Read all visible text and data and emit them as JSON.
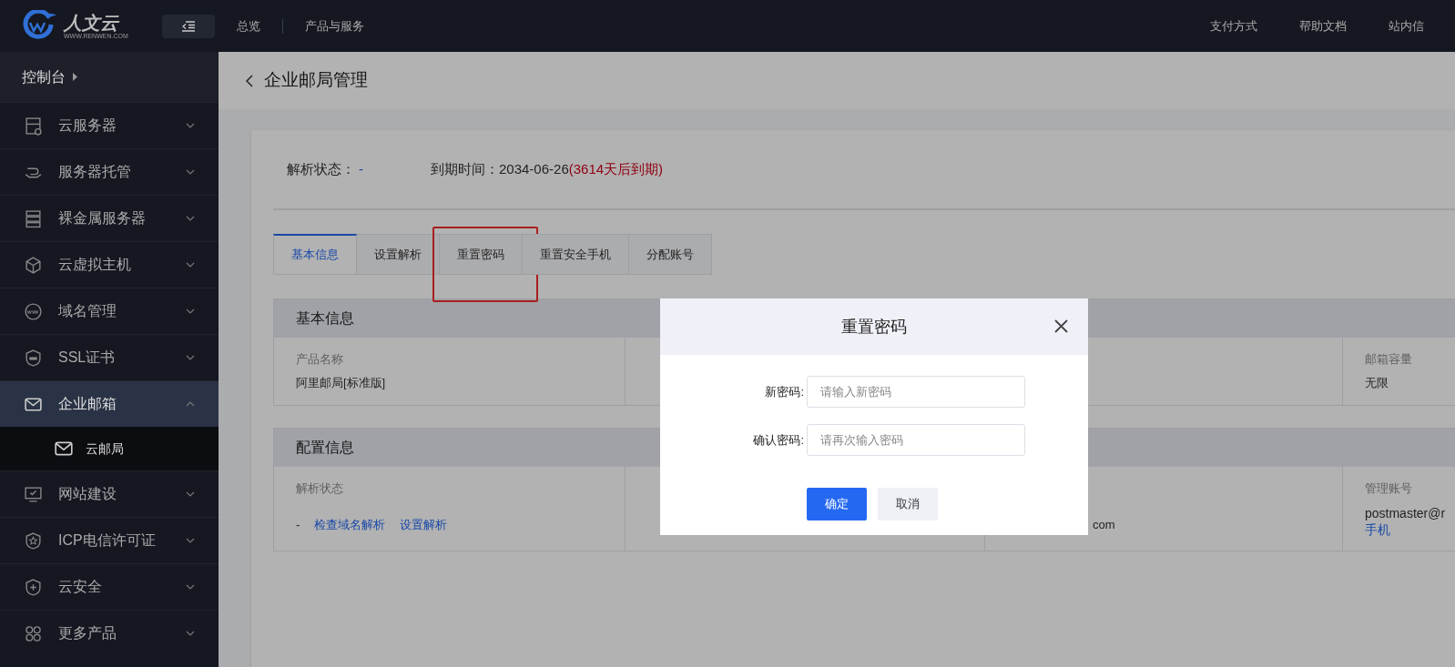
{
  "header": {
    "logo_text": "人文云",
    "logo_sub": "WWW.RENWEN.COM",
    "nav": [
      "总览",
      "产品与服务"
    ],
    "right_links": [
      "支付方式",
      "帮助文档",
      "站内信"
    ]
  },
  "sidebar": {
    "title": "控制台",
    "items": [
      {
        "label": "云服务器",
        "expanded": false,
        "selected": false
      },
      {
        "label": "服务器托管",
        "expanded": false,
        "selected": false
      },
      {
        "label": "裸金属服务器",
        "expanded": false,
        "selected": false
      },
      {
        "label": "云虚拟主机",
        "expanded": false,
        "selected": false
      },
      {
        "label": "域名管理",
        "expanded": false,
        "selected": false
      },
      {
        "label": "SSL证书",
        "expanded": false,
        "selected": false
      },
      {
        "label": "企业邮箱",
        "expanded": true,
        "selected": true,
        "children": [
          {
            "label": "云邮局"
          }
        ]
      },
      {
        "label": "网站建设",
        "expanded": false,
        "selected": false
      },
      {
        "label": "ICP电信许可证",
        "expanded": false,
        "selected": false
      },
      {
        "label": "云安全",
        "expanded": false,
        "selected": false
      },
      {
        "label": "更多产品",
        "expanded": false,
        "selected": false
      }
    ]
  },
  "page": {
    "title": "企业邮局管理",
    "status": [
      {
        "label": "解析状态：",
        "value": "-",
        "kind": "link"
      },
      {
        "label": "到期时间：",
        "value": "2034-06-26",
        "note": "(3614天后到期)",
        "kind": "date"
      }
    ],
    "tabs": [
      {
        "label": "基本信息",
        "selected": true,
        "highlighted": false
      },
      {
        "label": "设置解析",
        "selected": false,
        "highlighted": false
      },
      {
        "label": "重置密码",
        "selected": false,
        "highlighted": true
      },
      {
        "label": "重置安全手机",
        "selected": false,
        "highlighted": false
      },
      {
        "label": "分配账号",
        "selected": false,
        "highlighted": false
      }
    ],
    "sections": [
      {
        "title": "基本信息",
        "cells": [
          {
            "label": "产品名称",
            "values": [
              {
                "text": "阿里邮局[标准版]",
                "kind": "text"
              }
            ]
          },
          {},
          {},
          {
            "label": "邮箱容量",
            "values": [
              {
                "text": "无限",
                "kind": "text"
              }
            ]
          }
        ]
      },
      {
        "title": "配置信息",
        "cells": [
          {
            "label": "解析状态",
            "values": [
              {
                "text": "-",
                "kind": "text"
              },
              {
                "text": "检查域名解析",
                "kind": "link"
              },
              {
                "text": "设置解析",
                "kind": "link"
              }
            ]
          },
          {},
          {
            "values": [
              {
                "text": "com",
                "kind": "text"
              }
            ]
          },
          {
            "label": "管理账号",
            "lines": [
              {
                "text": "postmaster@r",
                "kind": "text"
              },
              {
                "text": "手机",
                "kind": "link"
              }
            ]
          }
        ]
      }
    ]
  },
  "dialog": {
    "title": "重置密码",
    "fields": [
      {
        "label": "新密码:",
        "placeholder": "请输入新密码"
      },
      {
        "label": "确认密码:",
        "placeholder": "请再次输入密码"
      }
    ],
    "buttons": [
      {
        "label": "确定",
        "kind": "primary"
      },
      {
        "label": "取消",
        "kind": "secondary"
      }
    ]
  }
}
